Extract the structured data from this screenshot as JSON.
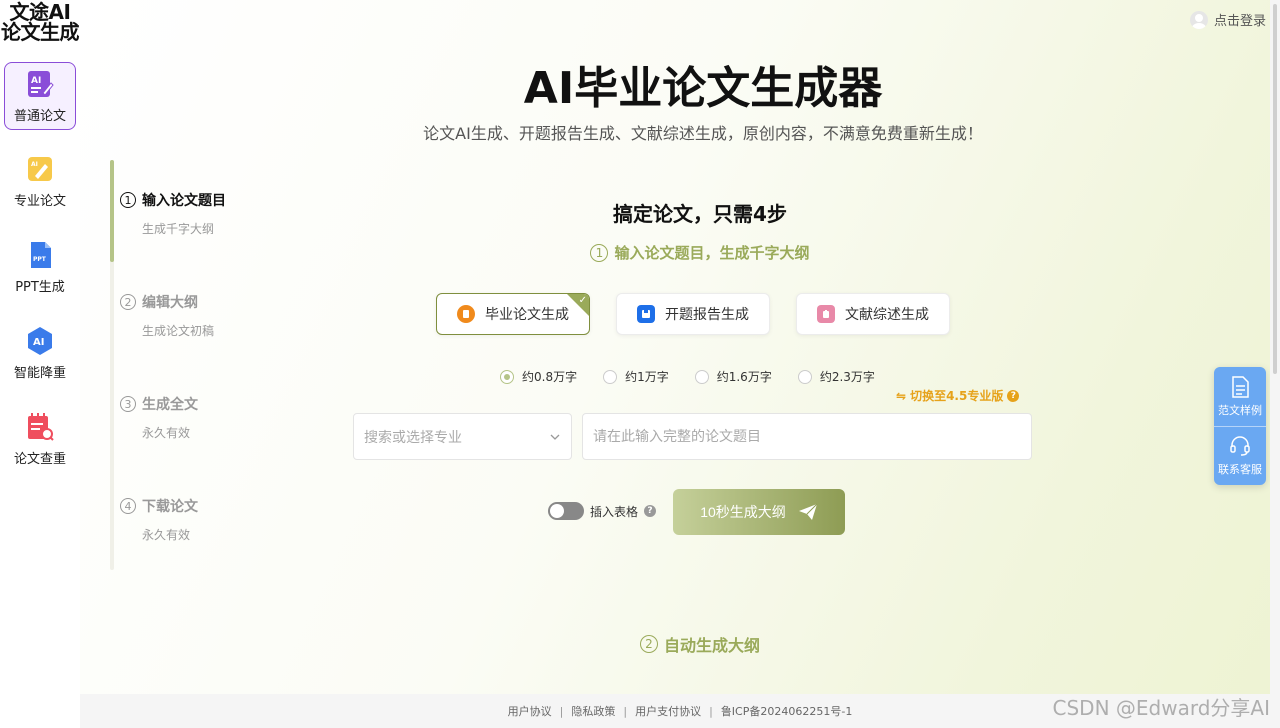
{
  "sidebar": {
    "logo": "文途AI论文生成",
    "items": [
      {
        "label": "普通论文",
        "icon": "ai-doc-icon",
        "active": true
      },
      {
        "label": "专业论文",
        "icon": "pro-doc-icon"
      },
      {
        "label": "PPT生成",
        "icon": "ppt-icon"
      },
      {
        "label": "智能降重",
        "icon": "ai-badge-icon"
      },
      {
        "label": "论文查重",
        "icon": "check-doc-icon"
      }
    ]
  },
  "header": {
    "login_label": "点击登录"
  },
  "hero": {
    "title": "AI毕业论文生成器",
    "subtitle": "论文AI生成、开题报告生成、文献综述生成，原创内容，不满意免费重新生成！"
  },
  "steps": [
    {
      "num": "1",
      "title": "输入论文题目",
      "sub": "生成千字大纲"
    },
    {
      "num": "2",
      "title": "编辑大纲",
      "sub": "生成论文初稿"
    },
    {
      "num": "3",
      "title": "生成全文",
      "sub": "永久有效"
    },
    {
      "num": "4",
      "title": "下载论文",
      "sub": "永久有效"
    }
  ],
  "form": {
    "heading": "搞定论文，只需4步",
    "step_num": "1",
    "step_label": "输入论文题目，生成千字大纲",
    "types": [
      {
        "label": "毕业论文生成",
        "color": "#f08a1c"
      },
      {
        "label": "开题报告生成",
        "color": "#1e6fe8"
      },
      {
        "label": "文献综述生成",
        "color": "#e889a8"
      }
    ],
    "word_options": [
      "约0.8万字",
      "约1万字",
      "约1.6万字",
      "约2.3万字"
    ],
    "switch_pro": "切换至4.5专业版",
    "major_placeholder": "搜索或选择专业",
    "title_placeholder": "请在此输入完整的论文题目",
    "insert_table": "插入表格",
    "generate_button": "10秒生成大纲",
    "next_step_num": "2",
    "next_step_label": "自动生成大纲"
  },
  "float": {
    "sample": "范文样例",
    "service": "联系客服"
  },
  "footer": {
    "links": [
      "用户协议",
      "隐私政策",
      "用户支付协议",
      "鲁ICP备2024062251号-1"
    ],
    "sep": "|"
  },
  "watermark": "CSDN @Edward分享AI"
}
